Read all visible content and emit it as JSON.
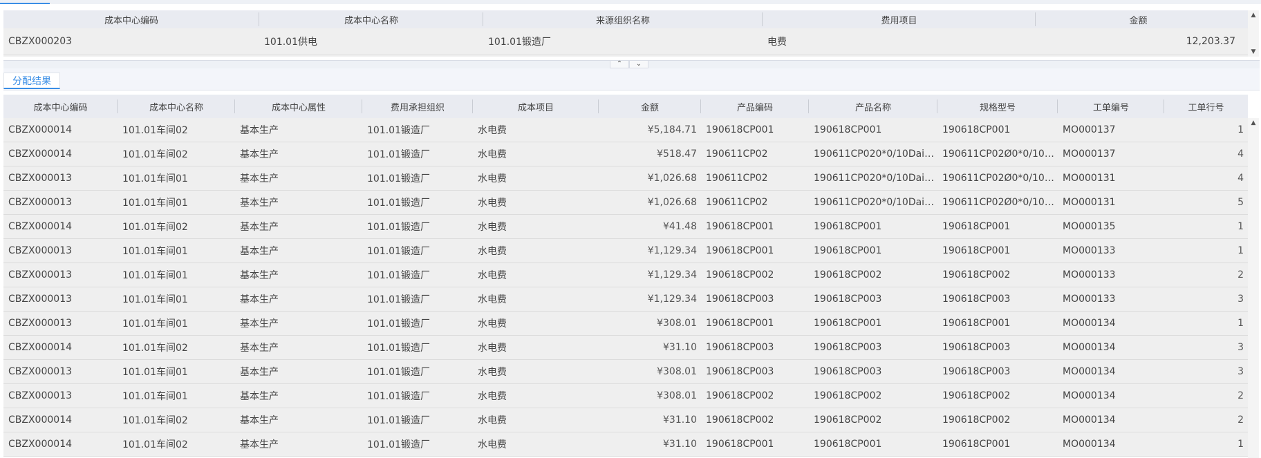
{
  "upper_table": {
    "columns": [
      "成本中心编码",
      "成本中心名称",
      "来源组织名称",
      "费用项目",
      "金额"
    ],
    "rows": [
      [
        "CBZX000203",
        "101.01供电",
        "101.01锻造厂",
        "电费",
        "12,203.37"
      ]
    ]
  },
  "tab": {
    "label": "分配结果"
  },
  "result_table": {
    "columns": [
      "成本中心编码",
      "成本中心名称",
      "成本中心属性",
      "费用承担组织",
      "成本项目",
      "金额",
      "产品编码",
      "产品名称",
      "规格型号",
      "工单编号",
      "工单行号"
    ],
    "rows": [
      [
        "CBZX000014",
        "101.01车间02",
        "基本生产",
        "101.01锻造厂",
        "水电费",
        "¥5,184.71",
        "190618CP001",
        "190618CP001",
        "190618CP001",
        "MO000137",
        "1"
      ],
      [
        "CBZX000014",
        "101.01车间02",
        "基本生产",
        "101.01锻造厂",
        "水电费",
        "¥518.47",
        "190611CP02",
        "190611CP020*0/10Daimle...",
        "190611CP02Ø0*0/10Dai...",
        "MO000137",
        "4"
      ],
      [
        "CBZX000013",
        "101.01车间01",
        "基本生产",
        "101.01锻造厂",
        "水电费",
        "¥1,026.68",
        "190611CP02",
        "190611CP020*0/10Daimle...",
        "190611CP02Ø0*0/10Dai...",
        "MO000131",
        "4"
      ],
      [
        "CBZX000013",
        "101.01车间01",
        "基本生产",
        "101.01锻造厂",
        "水电费",
        "¥1,026.68",
        "190611CP02",
        "190611CP020*0/10Daimle...",
        "190611CP02Ø0*0/10Dai...",
        "MO000131",
        "5"
      ],
      [
        "CBZX000014",
        "101.01车间02",
        "基本生产",
        "101.01锻造厂",
        "水电费",
        "¥41.48",
        "190618CP001",
        "190618CP001",
        "190618CP001",
        "MO000135",
        "1"
      ],
      [
        "CBZX000013",
        "101.01车间01",
        "基本生产",
        "101.01锻造厂",
        "水电费",
        "¥1,129.34",
        "190618CP001",
        "190618CP001",
        "190618CP001",
        "MO000133",
        "1"
      ],
      [
        "CBZX000013",
        "101.01车间01",
        "基本生产",
        "101.01锻造厂",
        "水电费",
        "¥1,129.34",
        "190618CP002",
        "190618CP002",
        "190618CP002",
        "MO000133",
        "2"
      ],
      [
        "CBZX000013",
        "101.01车间01",
        "基本生产",
        "101.01锻造厂",
        "水电费",
        "¥1,129.34",
        "190618CP003",
        "190618CP003",
        "190618CP003",
        "MO000133",
        "3"
      ],
      [
        "CBZX000013",
        "101.01车间01",
        "基本生产",
        "101.01锻造厂",
        "水电费",
        "¥308.01",
        "190618CP001",
        "190618CP001",
        "190618CP001",
        "MO000134",
        "1"
      ],
      [
        "CBZX000014",
        "101.01车间02",
        "基本生产",
        "101.01锻造厂",
        "水电费",
        "¥31.10",
        "190618CP003",
        "190618CP003",
        "190618CP003",
        "MO000134",
        "3"
      ],
      [
        "CBZX000013",
        "101.01车间01",
        "基本生产",
        "101.01锻造厂",
        "水电费",
        "¥308.01",
        "190618CP003",
        "190618CP003",
        "190618CP003",
        "MO000134",
        "3"
      ],
      [
        "CBZX000013",
        "101.01车间01",
        "基本生产",
        "101.01锻造厂",
        "水电费",
        "¥308.01",
        "190618CP002",
        "190618CP002",
        "190618CP002",
        "MO000134",
        "2"
      ],
      [
        "CBZX000014",
        "101.01车间02",
        "基本生产",
        "101.01锻造厂",
        "水电费",
        "¥31.10",
        "190618CP002",
        "190618CP002",
        "190618CP002",
        "MO000134",
        "2"
      ],
      [
        "CBZX000014",
        "101.01车间02",
        "基本生产",
        "101.01锻造厂",
        "水电费",
        "¥31.10",
        "190618CP001",
        "190618CP001",
        "190618CP001",
        "MO000134",
        "1"
      ]
    ]
  },
  "icons": {
    "scroll_up": "▲",
    "scroll_down": "▼",
    "collapse": "⌃",
    "expand": "⌄"
  },
  "colors": {
    "accent": "#3a8ee6",
    "header_bg": "#e9ebf1",
    "row_bg": "#efefef"
  }
}
